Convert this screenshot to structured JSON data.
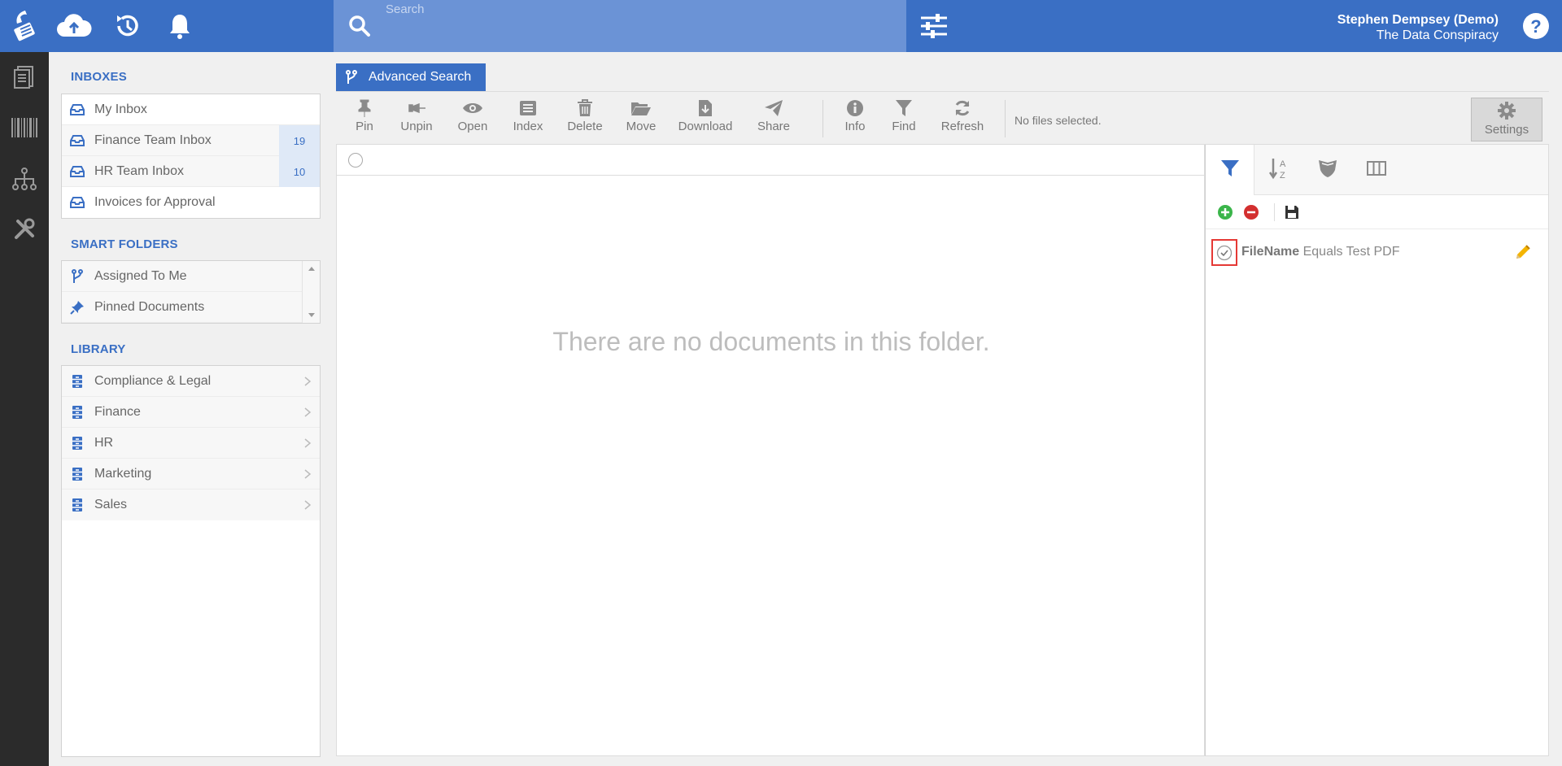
{
  "search": {
    "placeholder": "Search"
  },
  "user": {
    "name": "Stephen Dempsey (Demo)",
    "org": "The Data Conspiracy"
  },
  "sidebar": {
    "inboxes_title": "INBOXES",
    "inboxes": [
      {
        "label": "My Inbox",
        "count": ""
      },
      {
        "label": "Finance Team Inbox",
        "count": "19"
      },
      {
        "label": "HR Team Inbox",
        "count": "10"
      },
      {
        "label": "Invoices for Approval",
        "count": ""
      }
    ],
    "smart_title": "SMART FOLDERS",
    "smart": [
      {
        "label": "Assigned To Me"
      },
      {
        "label": "Pinned Documents"
      }
    ],
    "library_title": "LIBRARY",
    "library": [
      {
        "label": "Compliance & Legal"
      },
      {
        "label": "Finance"
      },
      {
        "label": "HR"
      },
      {
        "label": "Marketing"
      },
      {
        "label": "Sales"
      }
    ]
  },
  "main": {
    "tab_label": "Advanced Search",
    "toolbar": {
      "pin": "Pin",
      "unpin": "Unpin",
      "open": "Open",
      "index": "Index",
      "delete": "Delete",
      "move": "Move",
      "download": "Download",
      "share": "Share",
      "info": "Info",
      "find": "Find",
      "refresh": "Refresh",
      "status": "No files selected.",
      "settings": "Settings"
    },
    "empty_message": "There are no documents in this folder."
  },
  "filter_panel": {
    "criterion": {
      "field": "FileName",
      "rest": "Equals Test PDF"
    }
  },
  "colors": {
    "brand": "#3a6fc4",
    "rail": "#2b2b2b",
    "search": "#6b93d6",
    "accent_red": "#e53935"
  }
}
